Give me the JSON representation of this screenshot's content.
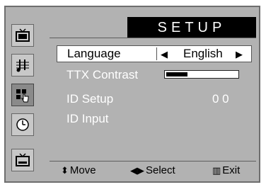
{
  "menu": {
    "title": "SETUP",
    "items": [
      {
        "label": "Language",
        "value": "English",
        "selected": true
      },
      {
        "label": "TTX Contrast",
        "level": 0.3
      },
      {
        "label": "ID Setup",
        "value": "0 0"
      },
      {
        "label": "ID Input"
      }
    ]
  },
  "footer": {
    "move_label": "Move",
    "select_label": "Select",
    "exit_label": "Exit",
    "move_glyph": "⬍",
    "select_glyph": "◀▶",
    "exit_glyph": "▥"
  },
  "arrows": {
    "left": "◀",
    "right": "▶"
  },
  "icons": [
    "picture-icon",
    "sound-icon",
    "setup-icon",
    "time-icon",
    "teletext-icon"
  ],
  "colors": {
    "background": "#b2b2b2",
    "title_bg": "#000000",
    "highlight": "#ffffff",
    "dim_text": "#ffffff"
  }
}
